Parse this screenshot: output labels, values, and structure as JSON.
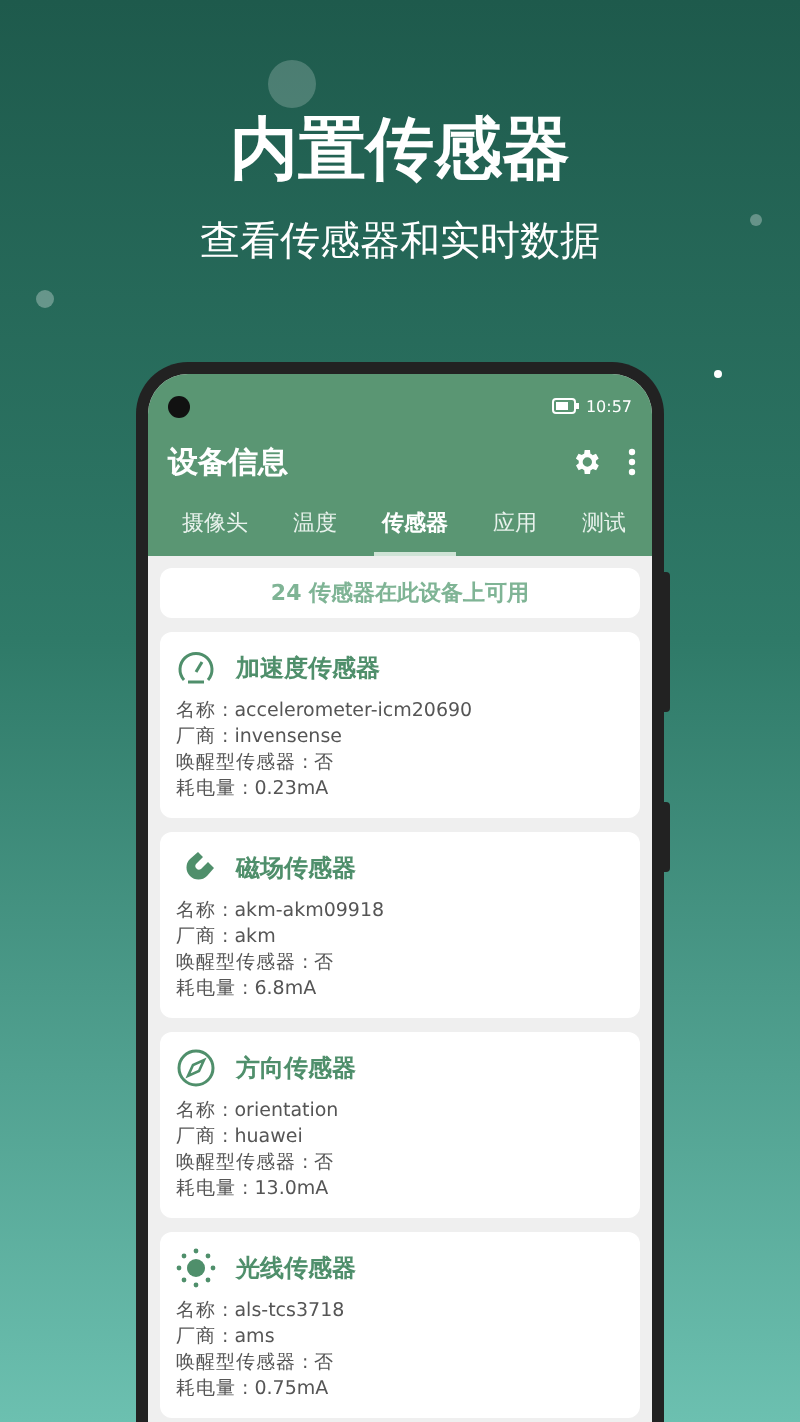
{
  "headline": "内置传感器",
  "subheadline": "查看传感器和实时数据",
  "status_bar": {
    "time": "10:57"
  },
  "toolbar": {
    "title": "设备信息"
  },
  "tabs": [
    {
      "label": "摄像头",
      "selected": false
    },
    {
      "label": "温度",
      "selected": false
    },
    {
      "label": "传感器",
      "selected": true
    },
    {
      "label": "应用",
      "selected": false
    },
    {
      "label": "测试",
      "selected": false
    }
  ],
  "summary": "24 传感器在此设备上可用",
  "sensors": [
    {
      "kind": "speed",
      "title": "加速度传感器",
      "lines": [
        "名称 : accelerometer-icm20690",
        "厂商 : invensense",
        "唤醒型传感器 : 否",
        "耗电量 : 0.23mA"
      ]
    },
    {
      "kind": "magnet",
      "title": "磁场传感器",
      "lines": [
        "名称 : akm-akm09918",
        "厂商 : akm",
        "唤醒型传感器 : 否",
        "耗电量 : 6.8mA"
      ]
    },
    {
      "kind": "compass",
      "title": "方向传感器",
      "lines": [
        "名称 : orientation",
        "厂商 : huawei",
        "唤醒型传感器 : 否",
        "耗电量 : 13.0mA"
      ]
    },
    {
      "kind": "light",
      "title": "光线传感器",
      "lines": [
        "名称 : als-tcs3718",
        "厂商 : ams",
        "唤醒型传感器 : 否",
        "耗电量 : 0.75mA"
      ]
    }
  ]
}
